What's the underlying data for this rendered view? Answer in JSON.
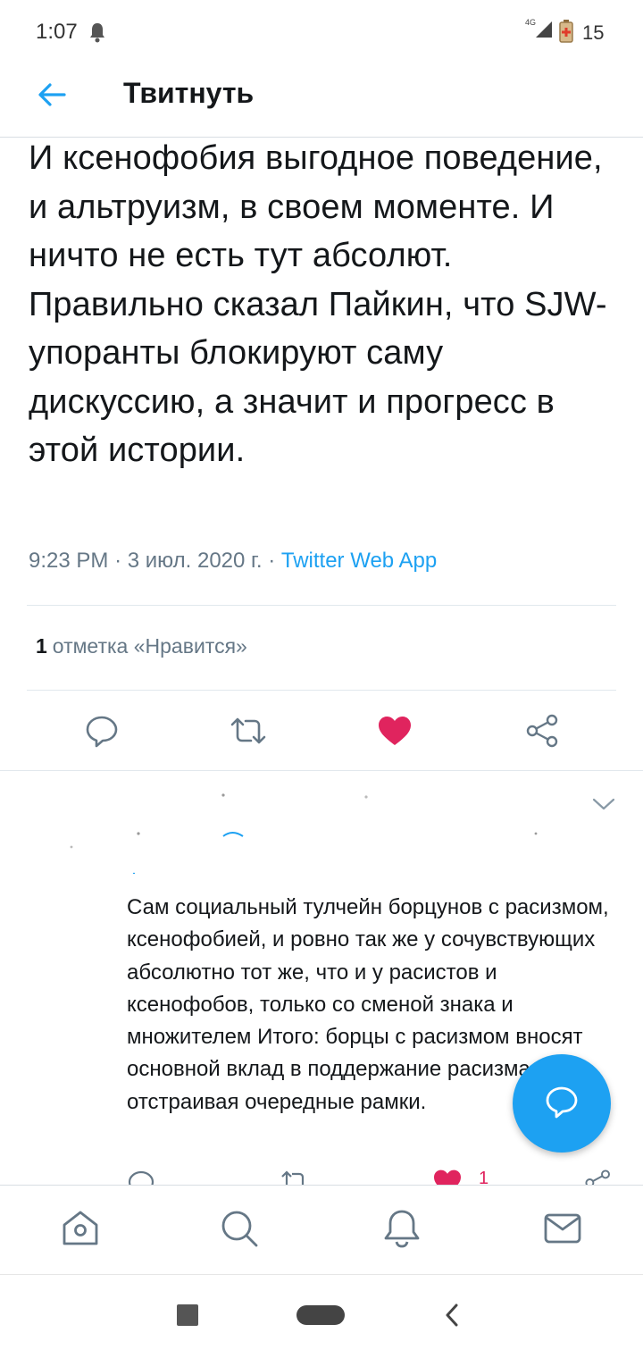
{
  "status_bar": {
    "time": "1:07",
    "network": "4G",
    "battery_level": "15",
    "icons": [
      "bell-icon",
      "signal-icon",
      "battery-icon"
    ]
  },
  "header": {
    "title": "Твитнуть",
    "back_icon": "arrow-left-icon"
  },
  "tweet": {
    "text": "И ксенофобия выгодное поведение, и альтруизм, в своем моменте. И ничто не есть тут абсолют.  Правильно сказал Пайкин, что SJW-упоранты блокируют саму дискуссию, а значит и прогресс в этой истории.",
    "time": "9:23 PM",
    "separator": "·",
    "date": "3 июл. 2020 г.",
    "source": "Twitter Web App",
    "like_count": "1",
    "like_label": "отметка «Нравится»",
    "liked": true
  },
  "reply": {
    "text": "Сам социальный тулчейн борцунов с расизмом, ксенофобией, и ровно так же у сочувствующих абсолютно тот же, что и у расистов и ксенофобов, только со сменой знака и множителем Итого: борцы с расизмом вносят основной вклад в поддержание расизма, отстраивая очередные рамки.",
    "like_count": "1"
  },
  "bottom_nav": [
    "home-icon",
    "search-icon",
    "notifications-icon",
    "messages-icon"
  ],
  "colors": {
    "accent": "#1da1f2",
    "like": "#e0245e",
    "text": "#14171a",
    "muted": "#657786",
    "border": "#e1e8ed"
  }
}
